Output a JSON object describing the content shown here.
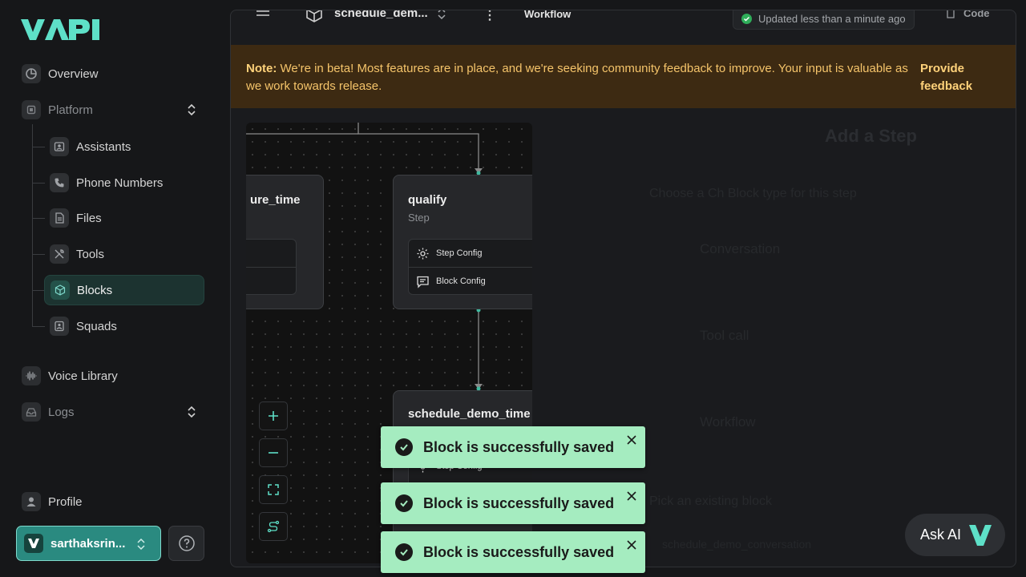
{
  "brand": {
    "logo_text": "VAPI"
  },
  "sidebar": {
    "overview": "Overview",
    "platform": "Platform",
    "platform_items": [
      {
        "label": "Assistants",
        "icon": "assistant-icon"
      },
      {
        "label": "Phone Numbers",
        "icon": "phone-icon"
      },
      {
        "label": "Files",
        "icon": "file-icon"
      },
      {
        "label": "Tools",
        "icon": "tools-icon"
      },
      {
        "label": "Blocks",
        "icon": "cube-icon",
        "active": true
      },
      {
        "label": "Squads",
        "icon": "squad-icon"
      }
    ],
    "voice_library": "Voice Library",
    "logs": "Logs",
    "profile": "Profile",
    "org_name": "sarthaksrin..."
  },
  "topbar": {
    "block_name": "schedule_dem...",
    "workflow_label": "Workflow",
    "updated": "Updated less than a minute ago",
    "code": "Code"
  },
  "beta": {
    "note_label": "Note:",
    "note_text": "We're in beta! Most features are in place, and we're seeking community feedback to improve. Your input is valuable as we work towards release.",
    "feedback": "Provide feedback"
  },
  "canvas": {
    "left_node_title": "ure_time",
    "qualify_title": "qualify",
    "qualify_sub": "Step",
    "step_config": "Step Config",
    "block_config": "Block Config",
    "bottom_node_title": "schedule_demo_time",
    "bottom_step_config": "Step Config"
  },
  "add_step_panel": {
    "title": "Add a Step",
    "subtitle": "Choose a Ch Block type for this step",
    "options": [
      "Conversation",
      "Tool call",
      "Workflow"
    ],
    "existing": "Pick an existing block",
    "existing_value": "schedule_demo_conversation"
  },
  "ask_ai": "Ask AI",
  "toasts": [
    "Block is successfully saved",
    "Block is successfully saved",
    "Block is successfully saved"
  ],
  "colors": {
    "accent": "#5ee0c8",
    "toast": "#a5ecc0",
    "beta_bg": "#3d2a12",
    "beta_text": "#f5c46a"
  }
}
